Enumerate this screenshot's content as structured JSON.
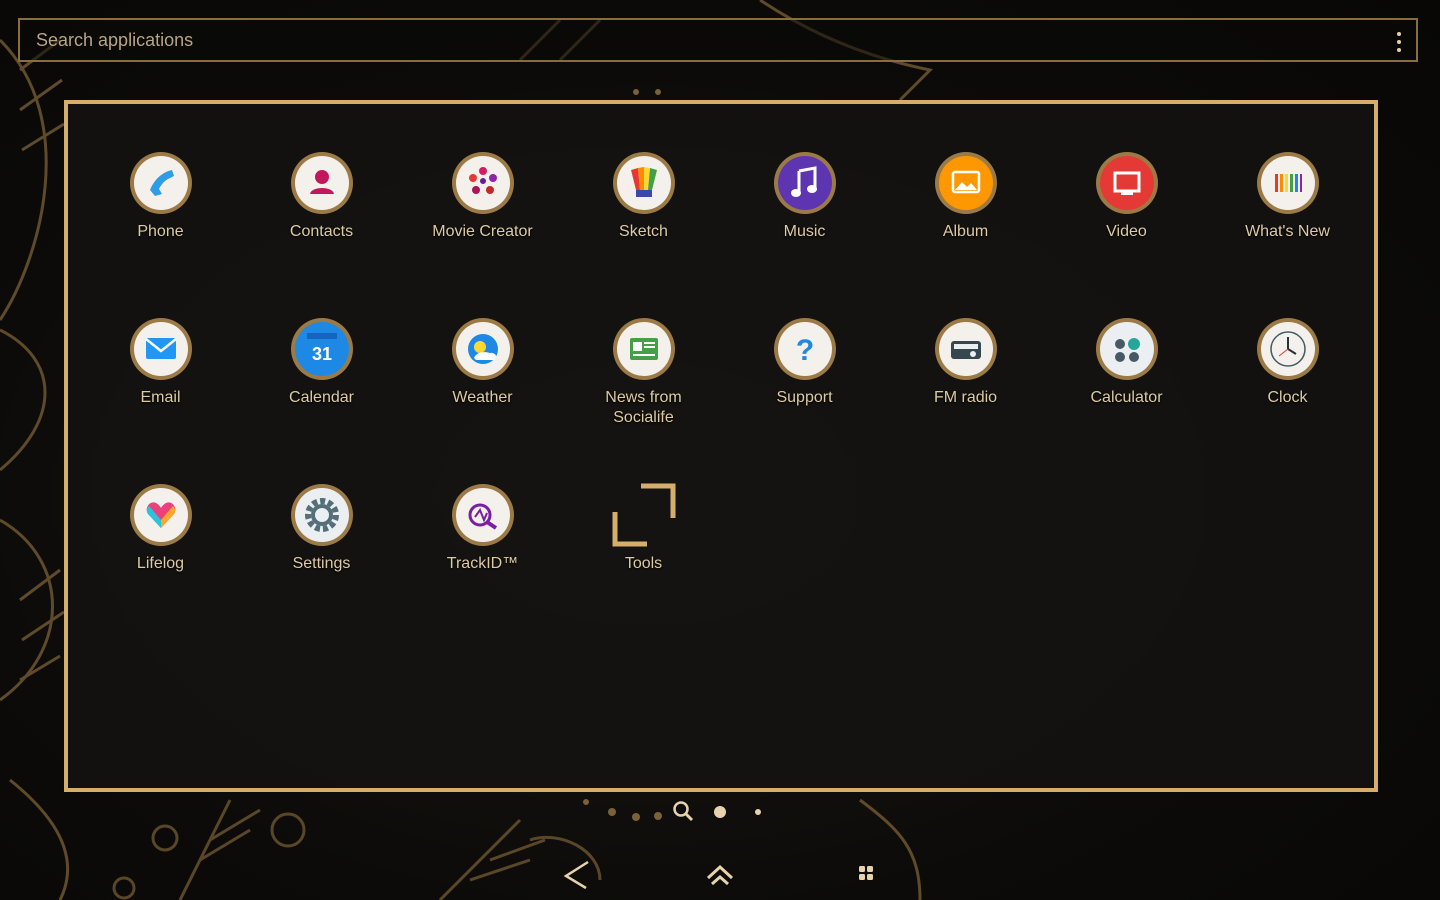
{
  "search": {
    "placeholder": "Search applications"
  },
  "colors": {
    "accent": "#d6ae6c",
    "label": "#ddcaa3",
    "background": "#0c0b09"
  },
  "apps": [
    {
      "label": "Phone",
      "icon": "phone-icon",
      "color": "#2f9de6"
    },
    {
      "label": "Contacts",
      "icon": "contacts-icon",
      "color": "#c2185b"
    },
    {
      "label": "Movie Creator",
      "icon": "movie-creator-icon",
      "color": "#d81b60"
    },
    {
      "label": "Sketch",
      "icon": "sketch-icon",
      "color": "#f9a825"
    },
    {
      "label": "Music",
      "icon": "music-icon",
      "color": "#5e35b1"
    },
    {
      "label": "Album",
      "icon": "album-icon",
      "color": "#ff9800"
    },
    {
      "label": "Video",
      "icon": "video-icon",
      "color": "#e53935"
    },
    {
      "label": "What's New",
      "icon": "whats-new-icon",
      "color": "#f5f5f5"
    },
    {
      "label": "Email",
      "icon": "email-icon",
      "color": "#2196f3"
    },
    {
      "label": "Calendar",
      "icon": "calendar-icon",
      "color": "#1e88e5",
      "badge": "31"
    },
    {
      "label": "Weather",
      "icon": "weather-icon",
      "color": "#1565c0"
    },
    {
      "label": "News from Socialife",
      "icon": "news-icon",
      "color": "#43a047"
    },
    {
      "label": "Support",
      "icon": "support-icon",
      "color": "#eceff1"
    },
    {
      "label": "FM radio",
      "icon": "fm-radio-icon",
      "color": "#eeeeee"
    },
    {
      "label": "Calculator",
      "icon": "calculator-icon",
      "color": "#546e7a"
    },
    {
      "label": "Clock",
      "icon": "clock-icon",
      "color": "#f5f5f5"
    },
    {
      "label": "Lifelog",
      "icon": "lifelog-icon",
      "color": "#f5f5f5"
    },
    {
      "label": "Settings",
      "icon": "settings-icon",
      "color": "#eceff1"
    },
    {
      "label": "TrackID™",
      "icon": "trackid-icon",
      "color": "#7b1fa2"
    },
    {
      "label": "Tools",
      "icon": "tools-folder-icon",
      "color": "#d6ae6c"
    }
  ],
  "pager": {
    "current_page": 1,
    "total_pages": 2
  },
  "navigation": {
    "back": "back-icon",
    "home": "home-icon",
    "recent": "recent-apps-icon"
  }
}
